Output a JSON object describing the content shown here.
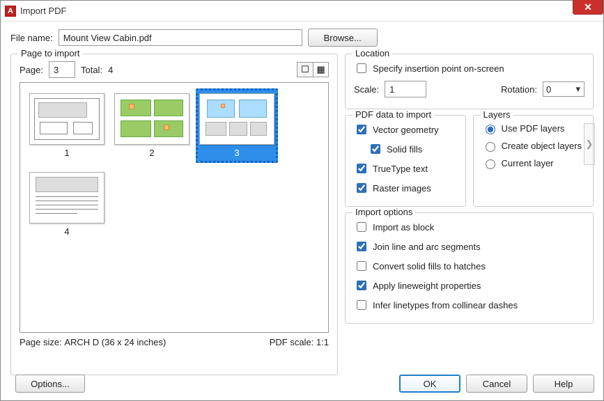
{
  "window": {
    "title": "Import PDF",
    "app_icon_letter": "A"
  },
  "file": {
    "label": "File name:",
    "value": "Mount View Cabin.pdf",
    "browse": "Browse..."
  },
  "pageToImport": {
    "legend": "Page to import",
    "pageLabel": "Page:",
    "pageValue": "3",
    "totalLabel": "Total:",
    "totalValue": "4",
    "thumbs": [
      {
        "caption": "1",
        "selected": false
      },
      {
        "caption": "2",
        "selected": false
      },
      {
        "caption": "3",
        "selected": true
      },
      {
        "caption": "4",
        "selected": false
      }
    ],
    "pageSizeLabel": "Page size:",
    "pageSizeValue": "ARCH D (36 x 24 inches)",
    "pdfScaleLabel": "PDF scale:",
    "pdfScaleValue": "1:1"
  },
  "location": {
    "legend": "Location",
    "specify": {
      "label": "Specify insertion point on-screen",
      "checked": false
    },
    "scaleLabel": "Scale:",
    "scaleValue": "1",
    "rotationLabel": "Rotation:",
    "rotationValue": "0"
  },
  "pdfData": {
    "legend": "PDF data to import",
    "vector": {
      "label": "Vector geometry",
      "checked": true
    },
    "solid": {
      "label": "Solid fills",
      "checked": true
    },
    "tt": {
      "label": "TrueType text",
      "checked": true
    },
    "raster": {
      "label": "Raster images",
      "checked": true
    }
  },
  "layers": {
    "legend": "Layers",
    "options": [
      {
        "label": "Use PDF layers",
        "selected": true
      },
      {
        "label": "Create object layers",
        "selected": false
      },
      {
        "label": "Current layer",
        "selected": false
      }
    ]
  },
  "importOptions": {
    "legend": "Import options",
    "block": {
      "label": "Import as block",
      "checked": false
    },
    "join": {
      "label": "Join line and arc segments",
      "checked": true
    },
    "hatch": {
      "label": "Convert solid fills to hatches",
      "checked": false
    },
    "lineweight": {
      "label": "Apply lineweight properties",
      "checked": true
    },
    "linetype": {
      "label": "Infer linetypes from collinear dashes",
      "checked": false
    }
  },
  "buttons": {
    "options": "Options...",
    "ok": "OK",
    "cancel": "Cancel",
    "help": "Help"
  }
}
